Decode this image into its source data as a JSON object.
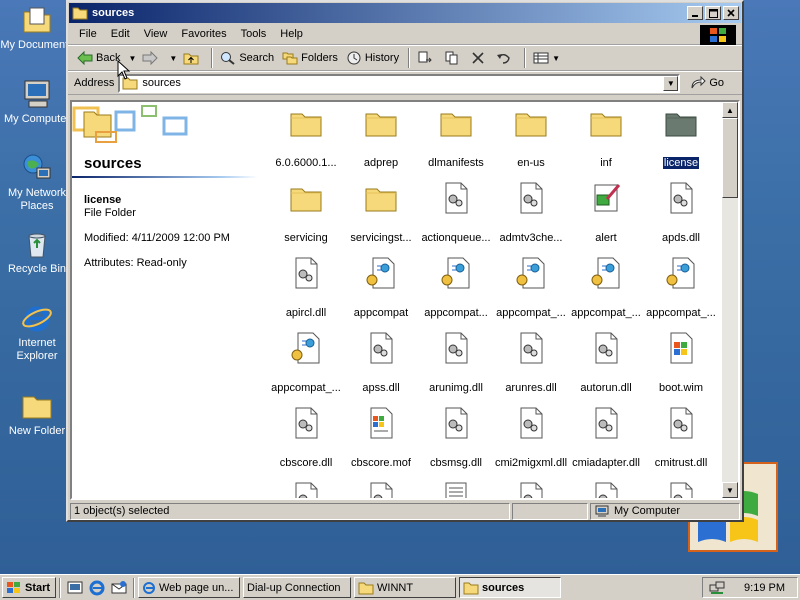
{
  "desktop": {
    "icons": [
      {
        "label": "My Documents",
        "icon": "my-documents-icon"
      },
      {
        "label": "My Computer",
        "icon": "my-computer-icon"
      },
      {
        "label": "My Network Places",
        "icon": "network-places-icon"
      },
      {
        "label": "Recycle Bin",
        "icon": "recycle-bin-icon"
      },
      {
        "label": "Internet Explorer",
        "icon": "internet-explorer-icon"
      },
      {
        "label": "New Folder",
        "icon": "folder-icon"
      }
    ]
  },
  "window": {
    "title": "sources",
    "menu": [
      "File",
      "Edit",
      "View",
      "Favorites",
      "Tools",
      "Help"
    ],
    "toolbar": {
      "back": "Back",
      "search": "Search",
      "folders": "Folders",
      "history": "History"
    },
    "address": {
      "label": "Address",
      "value": "sources",
      "go": "Go"
    },
    "info_pane": {
      "folder_title": "sources",
      "selected_name": "license",
      "selected_type": "File Folder",
      "modified": "Modified: 4/11/2009 12:00 PM",
      "attributes": "Attributes: Read-only"
    },
    "files": [
      {
        "name": "6.0.6000.1...",
        "kind": "folder"
      },
      {
        "name": "adprep",
        "kind": "folder"
      },
      {
        "name": "dlmanifests",
        "kind": "folder"
      },
      {
        "name": "en-us",
        "kind": "folder"
      },
      {
        "name": "inf",
        "kind": "folder"
      },
      {
        "name": "license",
        "kind": "folder-selected"
      },
      {
        "name": "servicing",
        "kind": "folder"
      },
      {
        "name": "servicingst...",
        "kind": "folder"
      },
      {
        "name": "actionqueue...",
        "kind": "dll"
      },
      {
        "name": "admtv3che...",
        "kind": "dll"
      },
      {
        "name": "alert",
        "kind": "alert"
      },
      {
        "name": "apds.dll",
        "kind": "dll"
      },
      {
        "name": "apircl.dll",
        "kind": "dll"
      },
      {
        "name": "appcompat",
        "kind": "manifest"
      },
      {
        "name": "appcompat...",
        "kind": "manifest"
      },
      {
        "name": "appcompat_...",
        "kind": "manifest"
      },
      {
        "name": "appcompat_...",
        "kind": "manifest"
      },
      {
        "name": "appcompat_...",
        "kind": "manifest"
      },
      {
        "name": "appcompat_...",
        "kind": "manifest"
      },
      {
        "name": "apss.dll",
        "kind": "dll"
      },
      {
        "name": "arunimg.dll",
        "kind": "dll"
      },
      {
        "name": "arunres.dll",
        "kind": "dll"
      },
      {
        "name": "autorun.dll",
        "kind": "dll"
      },
      {
        "name": "boot.wim",
        "kind": "wim"
      },
      {
        "name": "cbscore.dll",
        "kind": "dll"
      },
      {
        "name": "cbscore.mof",
        "kind": "mof"
      },
      {
        "name": "cbsmsg.dll",
        "kind": "dll"
      },
      {
        "name": "cmi2migxml.dll",
        "kind": "dll"
      },
      {
        "name": "cmiadapter.dll",
        "kind": "dll"
      },
      {
        "name": "cmitrust.dll",
        "kind": "dll"
      },
      {
        "name": "",
        "kind": "dll"
      },
      {
        "name": "",
        "kind": "dll"
      },
      {
        "name": "",
        "kind": "text"
      },
      {
        "name": "",
        "kind": "dll"
      },
      {
        "name": "",
        "kind": "dll"
      },
      {
        "name": "",
        "kind": "dll"
      }
    ],
    "status": {
      "selection": "1 object(s) selected",
      "zone": "My Computer"
    }
  },
  "taskbar": {
    "start": "Start",
    "tasks": [
      "Web page un...",
      "Dial-up Connection",
      "WINNT",
      "sources"
    ],
    "active_task": "sources",
    "time": "9:19 PM"
  },
  "colors": {
    "desktop": "#3a6ea5",
    "titlebar_start": "#0a246a",
    "titlebar_end": "#a6caf0",
    "window_face": "#d4d0c8",
    "selection": "#0a246a"
  }
}
